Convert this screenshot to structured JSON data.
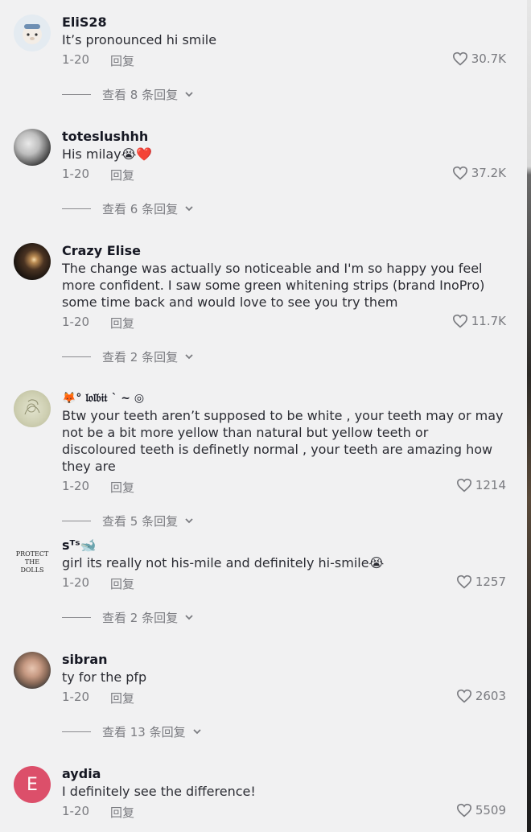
{
  "comments": [
    {
      "username": "EliS28",
      "text": "It’s pronounced hi smile",
      "date": "1-20",
      "reply_label": "回复",
      "likes": "30.7K",
      "view_replies": "查看 8 条回复",
      "avatar": "bear-avatar-icon"
    },
    {
      "username": "toteslushhh",
      "text": "His milay😭❤️",
      "date": "1-20",
      "reply_label": "回复",
      "likes": "37.2K",
      "view_replies": "查看 6 条回复",
      "avatar": "cat-photo-avatar"
    },
    {
      "username": "Crazy Elise",
      "text": "The change was actually so noticeable and I'm so happy you feel more confident. I saw some green whitening strips (brand InoPro) some time back and would love to see you try them",
      "date": "1-20",
      "reply_label": "回复",
      "likes": "11.7K",
      "view_replies": "查看 2 条回复",
      "avatar": "candle-photo-avatar"
    },
    {
      "username": "🦊° 𝔩𝔬𝔩𝔟𝔦𝔱 ` ~ ◎",
      "text": "Btw your teeth aren’t supposed to be white , your teeth may or may not be a bit more yellow than natural but yellow teeth or discoloured teeth is definetly normal , your teeth are amazing how they are",
      "date": "1-20",
      "reply_label": "回复",
      "likes": "1214",
      "view_replies": "查看 5 条回复",
      "avatar": "sketch-avatar"
    },
    {
      "username": "sᵀˢ🐋",
      "text": "girl its really not his-mile and definitely hi-smile😭",
      "date": "1-20",
      "reply_label": "回复",
      "likes": "1257",
      "view_replies": "查看 2 条回复",
      "avatar": "text-avatar",
      "avatar_text": [
        "PROTECT",
        "THE",
        "DOLLS"
      ]
    },
    {
      "username": "sibran",
      "text": "ty for the pfp",
      "date": "1-20",
      "reply_label": "回复",
      "likes": "2603",
      "view_replies": "查看 13 条回复",
      "avatar": "face-photo-avatar"
    },
    {
      "username": "aydia",
      "text": "I definitely see the difference!",
      "date": "1-20",
      "reply_label": "回复",
      "likes": "5509",
      "avatar": "letter-avatar",
      "avatar_letter": "E"
    }
  ]
}
